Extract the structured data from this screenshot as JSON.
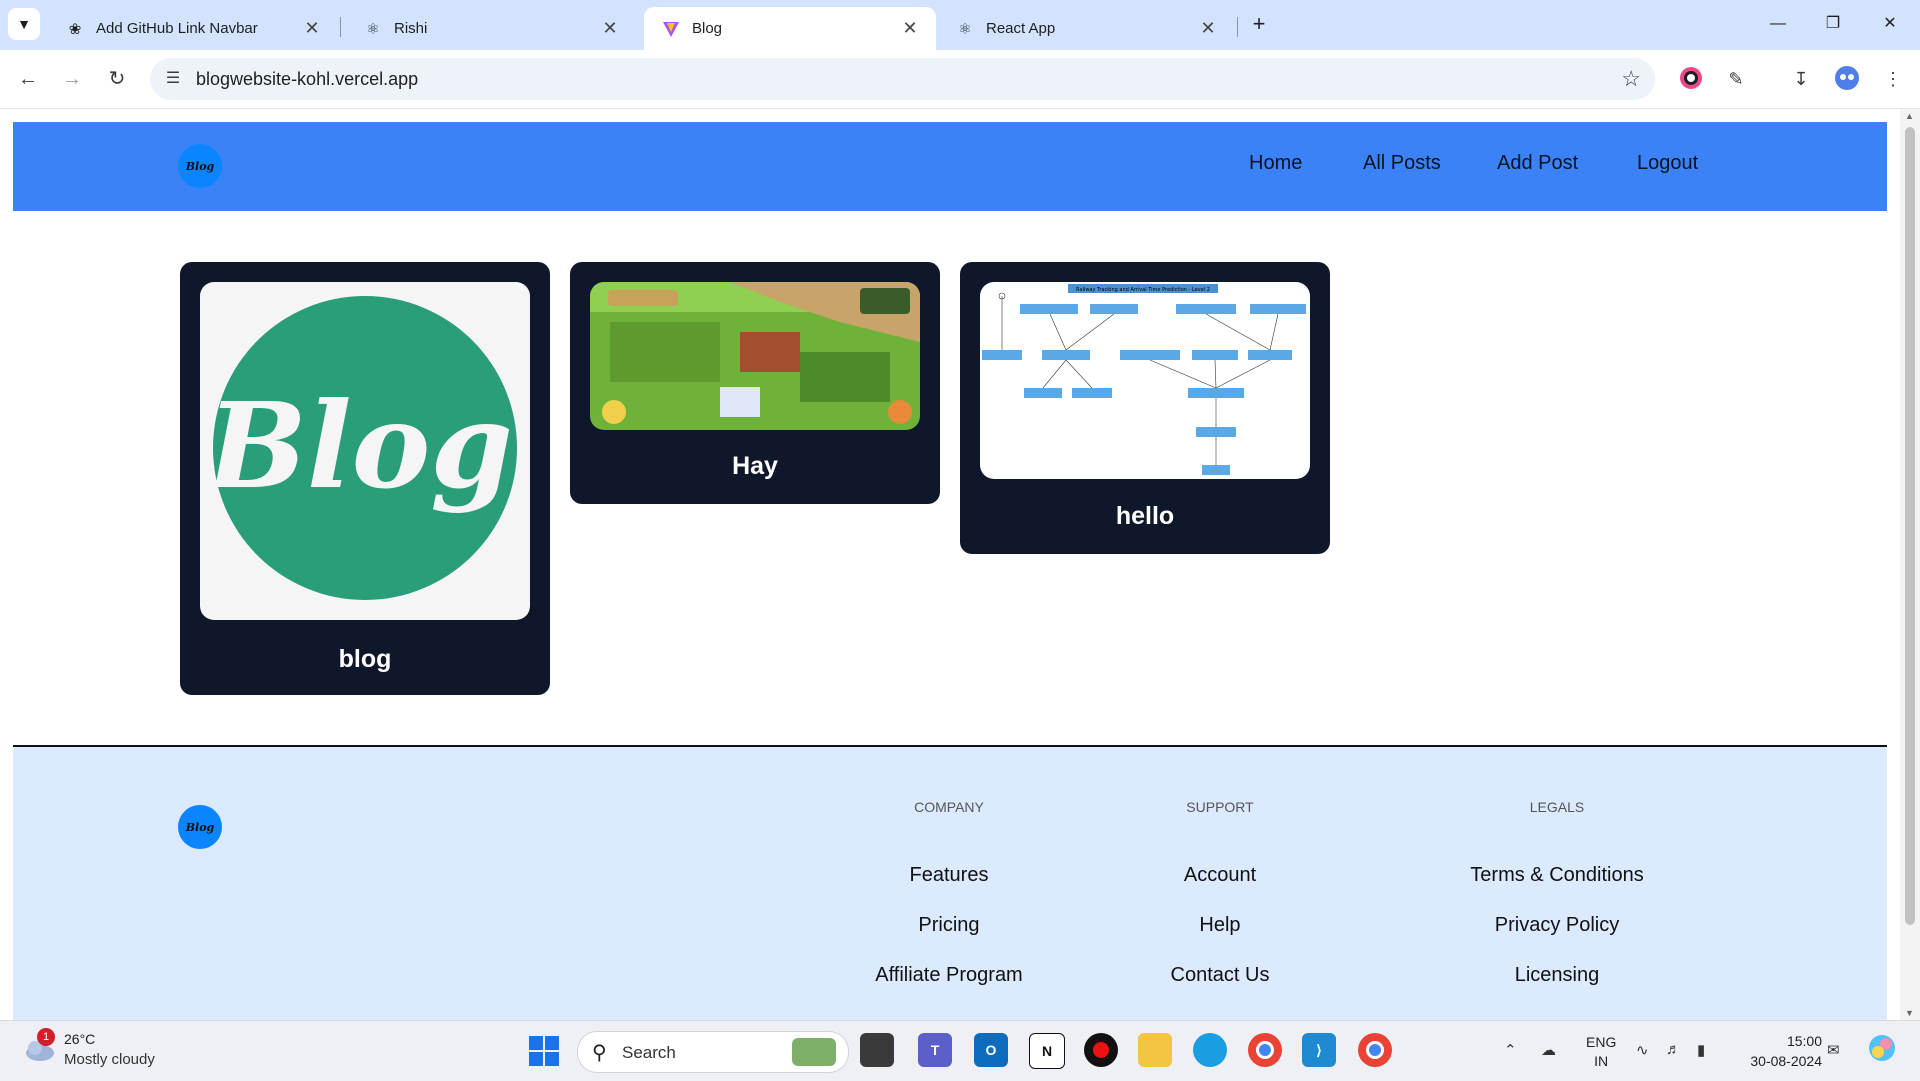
{
  "browser": {
    "tabs": [
      {
        "title": "Add GitHub Link Navbar",
        "icon": "openai-icon",
        "active": false
      },
      {
        "title": "Rishi",
        "icon": "react-icon",
        "active": false
      },
      {
        "title": "Blog",
        "icon": "vite-icon",
        "active": true
      },
      {
        "title": "React App",
        "icon": "react-icon",
        "active": false
      }
    ],
    "url": "blogwebsite-kohl.vercel.app"
  },
  "site": {
    "logo_text": "Blog",
    "nav": [
      "Home",
      "All Posts",
      "Add Post",
      "Logout"
    ],
    "posts": [
      {
        "title": "blog",
        "image": "blog-logo-image"
      },
      {
        "title": "Hay",
        "image": "hayday-game-screenshot"
      },
      {
        "title": "hello",
        "image": "railway-tracking-diagram"
      }
    ],
    "diagram_title": "Railway Tracking and Arrival Time Prediction - Level 2",
    "footer": {
      "columns": [
        {
          "heading": "Company",
          "links": [
            "Features",
            "Pricing",
            "Affiliate Program"
          ]
        },
        {
          "heading": "Support",
          "links": [
            "Account",
            "Help",
            "Contact Us"
          ]
        },
        {
          "heading": "Legals",
          "links": [
            "Terms & Conditions",
            "Privacy Policy",
            "Licensing"
          ]
        }
      ]
    }
  },
  "taskbar": {
    "weather_badge": "1",
    "temperature": "26°C",
    "weather": "Mostly cloudy",
    "search_label": "Search",
    "lang_top": "ENG",
    "lang_bottom": "IN",
    "time": "15:00",
    "date": "30-08-2024"
  },
  "colors": {
    "header": "#3b82f6",
    "card": "#0f172a",
    "footer": "#dbeafe",
    "logo": "#0a84ff",
    "blog_green": "#2a9d7b"
  }
}
